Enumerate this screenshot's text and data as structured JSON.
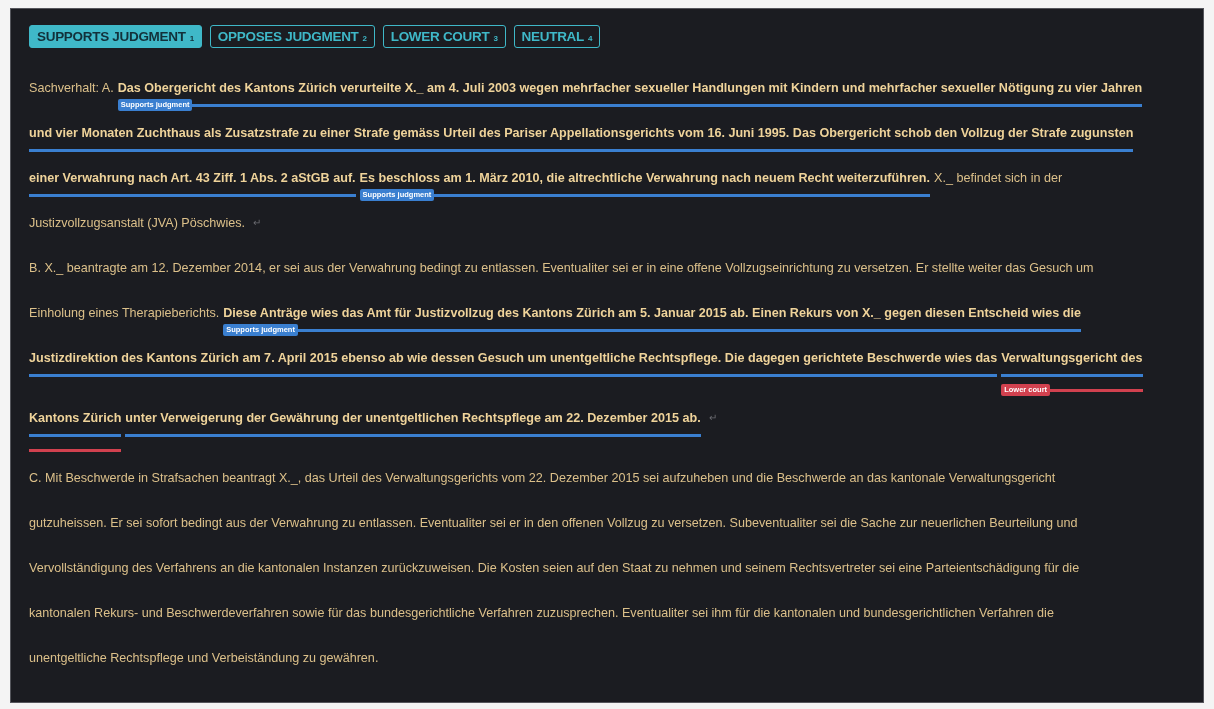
{
  "tabs": [
    {
      "label": "SUPPORTS JUDGMENT",
      "key": "1",
      "selected": true
    },
    {
      "label": "OPPOSES JUDGMENT",
      "key": "2",
      "selected": false
    },
    {
      "label": "LOWER COURT",
      "key": "3",
      "selected": false
    },
    {
      "label": "NEUTRAL",
      "key": "4",
      "selected": false
    }
  ],
  "lines": [
    {
      "segments": [
        {
          "text": "Sachverhalt: A.",
          "bold": false
        },
        {
          "text": "Das Obergericht des Kantons Zürich verurteilte X._ am 4. Juli 2003 wegen mehrfacher sexueller Handlungen mit Kindern und mehrfacher sexueller Nötigung zu vier Jahren",
          "bold": true,
          "marks": [
            {
              "kind": "supports",
              "label": "Supports judgment"
            }
          ]
        }
      ]
    },
    {
      "segments": [
        {
          "text": "und vier Monaten Zuchthaus als Zusatzstrafe zu einer Strafe gemäss Urteil des Pariser Appellationsgerichts vom 16. Juni 1995. Das Obergericht schob den Vollzug der Strafe zugunsten",
          "bold": true,
          "marks": [
            {
              "kind": "supports"
            }
          ]
        }
      ]
    },
    {
      "segments": [
        {
          "text": "einer Verwahrung nach Art. 43 Ziff. 1 Abs. 2 aStGB auf.",
          "bold": true,
          "marks": [
            {
              "kind": "supports"
            }
          ]
        },
        {
          "text": "Es beschloss am 1. März 2010, die altrechtliche Verwahrung nach neuem Recht weiterzuführen.",
          "bold": true,
          "marks": [
            {
              "kind": "supports",
              "label": "Supports judgment"
            }
          ]
        },
        {
          "text": "X._ befindet sich in der",
          "bold": false
        }
      ]
    },
    {
      "segments": [
        {
          "text": "Justizvollzugsanstalt (JVA) Pöschwies.",
          "bold": false
        }
      ],
      "end_mark": "↵"
    },
    {
      "segments": [
        {
          "text": "B. X._ beantragte am 12. Dezember 2014, er sei aus der Verwahrung bedingt zu entlassen. Eventualiter sei er in eine offene Vollzugseinrichtung zu versetzen. Er stellte weiter das Gesuch um",
          "bold": false
        }
      ]
    },
    {
      "segments": [
        {
          "text": "Einholung eines Therapieberichts.",
          "bold": false
        },
        {
          "text": "Diese Anträge wies das Amt für Justizvollzug des Kantons Zürich am 5. Januar 2015 ab. Einen Rekurs von X._ gegen diesen Entscheid wies die",
          "bold": true,
          "marks": [
            {
              "kind": "supports",
              "label": "Supports judgment"
            }
          ]
        }
      ]
    },
    {
      "segments": [
        {
          "text": "Justizdirektion des Kantons Zürich am 7. April 2015 ebenso ab wie dessen Gesuch um unentgeltliche Rechtspflege. Die dagegen gerichtete Beschwerde wies das",
          "bold": true,
          "marks": [
            {
              "kind": "supports"
            }
          ]
        },
        {
          "text": "Verwaltungsgericht des",
          "bold": true,
          "marks": [
            {
              "kind": "supports"
            },
            {
              "kind": "lower",
              "label": "Lower court"
            }
          ]
        }
      ]
    },
    {
      "segments": [
        {
          "text": "Kantons Zürich",
          "bold": true,
          "marks": [
            {
              "kind": "supports"
            },
            {
              "kind": "lower"
            }
          ]
        },
        {
          "text": "unter Verweigerung der Gewährung der unentgeltlichen Rechtspflege am 22. Dezember 2015 ab.",
          "bold": true,
          "marks": [
            {
              "kind": "supports"
            }
          ]
        }
      ],
      "end_mark": "↵"
    },
    {
      "segments": [
        {
          "text": "C. Mit Beschwerde in Strafsachen beantragt X._, das Urteil des Verwaltungsgerichts vom 22. Dezember 2015 sei aufzuheben und die Beschwerde an das kantonale Verwaltungsgericht",
          "bold": false
        }
      ]
    },
    {
      "segments": [
        {
          "text": "gutzuheissen. Er sei sofort bedingt aus der Verwahrung zu entlassen. Eventualiter sei er in den offenen Vollzug zu versetzen. Subeventualiter sei die Sache zur neuerlichen Beurteilung und",
          "bold": false
        }
      ]
    },
    {
      "segments": [
        {
          "text": "Vervollständigung des Verfahrens an die kantonalen Instanzen zurückzuweisen. Die Kosten seien auf den Staat zu nehmen und seinem Rechtsvertreter sei eine Parteientschädigung für die",
          "bold": false
        }
      ]
    },
    {
      "segments": [
        {
          "text": "kantonalen Rekurs- und Beschwerdeverfahren sowie für das bundesgerichtliche Verfahren zuzusprechen. Eventualiter sei ihm für die kantonalen und bundesgerichtlichen Verfahren die",
          "bold": false
        }
      ]
    },
    {
      "segments": [
        {
          "text": "unentgeltliche Rechtspflege und Verbeiständung zu gewähren.",
          "bold": false
        }
      ]
    }
  ]
}
